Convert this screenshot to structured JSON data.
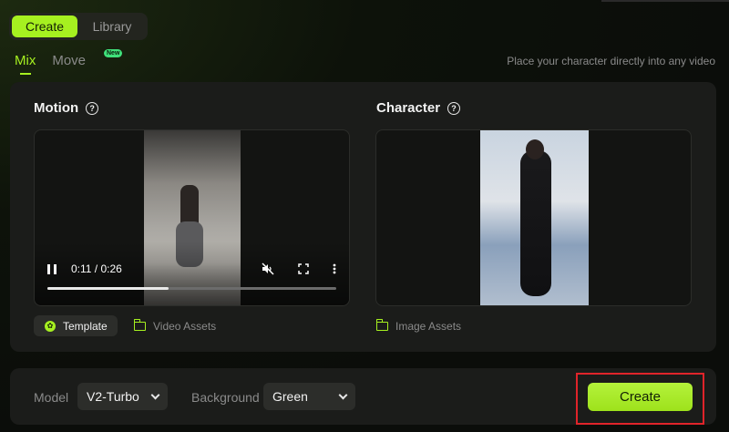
{
  "tabs": {
    "create_label": "Create",
    "library_label": "Library"
  },
  "subtabs": {
    "mix_label": "Mix",
    "move_label": "Move",
    "new_badge": "New"
  },
  "tagline": "Place your character directly into any video",
  "motion": {
    "title": "Motion",
    "time": "0:11 / 0:26",
    "progress": 0.42,
    "template_label": "Template",
    "video_assets_label": "Video Assets"
  },
  "character": {
    "title": "Character",
    "image_assets_label": "Image Assets"
  },
  "settings": {
    "model_label": "Model",
    "model_value": "V2-Turbo",
    "background_label": "Background",
    "background_value": "Green"
  },
  "create_button_label": "Create",
  "colors": {
    "accent": "#a6f020",
    "highlight_outline": "#e0242a"
  }
}
